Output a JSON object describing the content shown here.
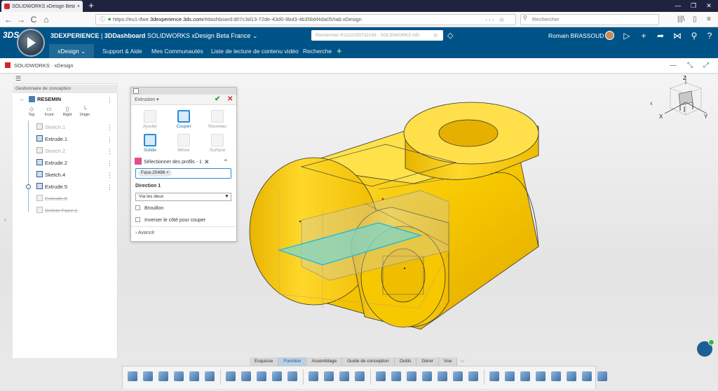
{
  "browser": {
    "tab_title": "SOLIDWORKS xDesign Beta France",
    "tab_close": "×",
    "new_tab": "+",
    "url_prefix": "https://eu1-ifwe.",
    "url_domain": "3dexperience.3ds.com",
    "url_rest": "/#dashboard:d07c3d13-72de-43d0-9bd3-4b35b6f4da05/tab:xDesign",
    "url_icons": "··· ☆",
    "search_placeholder": "Rechercher",
    "back": "←",
    "forward": "→",
    "reload": "C",
    "home": "⌂",
    "library_icon": "|||\\",
    "sidebar_icon": "▯",
    "menu_icon": "≡",
    "minimize": "—",
    "restore": "❐",
    "close": "✕"
  },
  "platform": {
    "logo": "3DS",
    "brand": "3DEXPERIENCE",
    "sep": " | ",
    "dashboard": "3DDashboard",
    "dashboard_name": " SOLIDWORKS xDesign Beta France ⌄",
    "search_placeholder": "Rechercher R1132100732199 - SOLIDWORKS AEI",
    "search_icon": "○",
    "tag_icon": "◇",
    "user_name": "Romain BRASSOUD",
    "icons": {
      "share": "▷",
      "add": "+",
      "forward": "➦",
      "network": "⋈",
      "tools": "⚲",
      "help": "?"
    },
    "tabs": {
      "xdesign": "xDesign ⌄",
      "support": "Support & Aide",
      "communities": "Mes Communautés",
      "videos": "Liste de lecture de contenu vidéo",
      "search": "Recherche",
      "add": "+"
    }
  },
  "app": {
    "title": "SOLIDWORKS · xDesign",
    "minimize": "—",
    "collapse": "⤡",
    "expand": "⤢"
  },
  "tree": {
    "header_icon": "☰",
    "label": "Gestionnaire de conception",
    "root": "RESEMIN",
    "root_chev": "⌵",
    "root_menu": "⋮",
    "planes": [
      {
        "icon": "◇",
        "label": "Top"
      },
      {
        "icon": "▭",
        "label": "Front"
      },
      {
        "icon": "▯",
        "label": "Right"
      },
      {
        "icon": "└",
        "label": "Origin"
      }
    ],
    "items": [
      {
        "label": "Sketch.1",
        "menu": "⋮"
      },
      {
        "label": "Extrude.1",
        "menu": "⋮"
      },
      {
        "label": "Sketch.2",
        "menu": "⋮"
      },
      {
        "label": "Extrude.2",
        "menu": "⋮"
      },
      {
        "label": "Sketch.4",
        "menu": "⋮"
      },
      {
        "label": "Extrude.5",
        "menu": "⋮"
      },
      {
        "label": "Extrude.6"
      },
      {
        "label": "Delete Face.1"
      }
    ],
    "collapse_arrow": "‹"
  },
  "extrusion": {
    "title": "Extrusion ▾",
    "ok": "✔",
    "cancel": "✕",
    "ops": [
      "Ajouter",
      "Couper",
      "Nouveau"
    ],
    "body_types": [
      "Solide",
      "Mince",
      "Surface"
    ],
    "select_profiles": "Sélectionner des profils - 1",
    "select_x": "✕",
    "select_up": "⌃",
    "chip": "Face.20496 ×",
    "direction_label": "Direction 1",
    "direction_value": "Via les deux",
    "direction_arrow": "▼",
    "draft": "Brouillon",
    "flip": "Inverser le côté pour couper",
    "advanced": "›   Avancé"
  },
  "viewcube": {
    "axis_x": "X",
    "axis_y": "Y",
    "axis_z": "Z",
    "left_arrow": "‹"
  },
  "command_tabs": [
    "Esquisse",
    "Fonction",
    "Assemblage",
    "Guide de conception",
    "Outils",
    "Gérer",
    "Vue"
  ],
  "command_tabs_active": 1,
  "command_tabs_toggle": "⌵",
  "colors": {
    "brand_blue": "#005386",
    "model_yellow": "#f7c800",
    "selection_cyan": "#3cc4d8",
    "accent": "#2a8ad4"
  }
}
